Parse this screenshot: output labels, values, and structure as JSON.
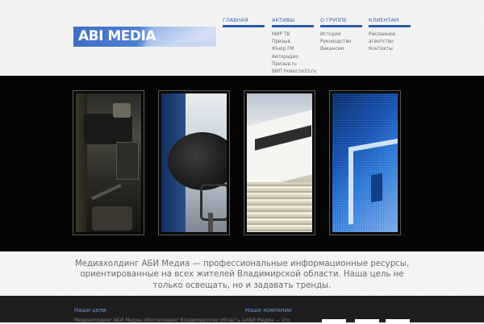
{
  "header": {
    "logo_text": "ABI MEDIA",
    "nav": [
      {
        "label": "ГЛАВНАЯ",
        "items": []
      },
      {
        "label": "АКТИВЫ",
        "items": [
          "МИР ТВ",
          "Призыв",
          "Юнор FM",
          "Авторадио",
          "Призыв.ru",
          "ВИП Новости33.ru"
        ]
      },
      {
        "label": "О ГРУППЕ",
        "items": [
          "История",
          "Руководство",
          "Вакансии"
        ]
      },
      {
        "label": "КЛИЕНТАМ",
        "items": [
          "Рекламное",
          "агентство",
          "Контакты"
        ]
      }
    ]
  },
  "showcase": {
    "tiles": [
      "camera-photo",
      "microphone-photo",
      "newspaper-photo",
      "screen-photo"
    ]
  },
  "tagline": "Медиахолдинг АБИ Медиа — профессиональные информационные ресурсы, ориентированные на всех жителей Владимирской области. Наша цель не только освещать, но и задавать тренды.",
  "footer": {
    "col1_title": "Наши цели",
    "col1_text": "Медиахолдинг АБИ Медиа обеспечивает Владимирскую область а",
    "col2_title": "Наши компании",
    "col2_text": "АБИ Медиа — это"
  },
  "colors": {
    "accent": "#2b5aa8",
    "nav_text": "#3b66b2",
    "band_bg": "#050505",
    "footer_bg": "#1e1e1e",
    "footer_head": "#6f97d8"
  }
}
